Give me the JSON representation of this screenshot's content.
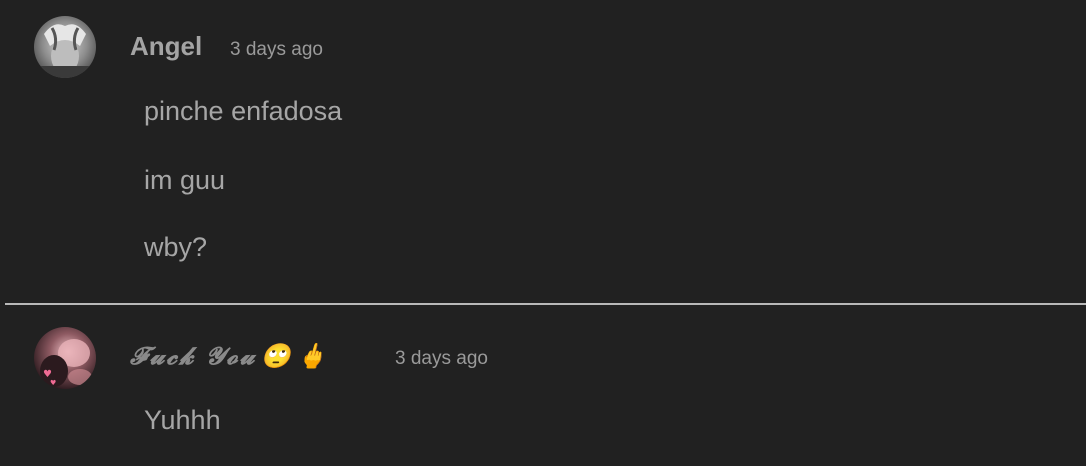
{
  "comments": [
    {
      "author": "Angel",
      "timestamp": "3 days ago",
      "lines": [
        "pinche enfadosa",
        "im guu",
        "wby?"
      ]
    },
    {
      "author": "𝓕𝓾𝓬𝓴 𝓨𝓸𝓾",
      "author_emojis": [
        "🙄",
        "🖕"
      ],
      "timestamp": "3 days ago",
      "lines": [
        "Yuhhh"
      ]
    }
  ],
  "colors": {
    "background": "#212121",
    "text": "#a3a3a3",
    "divider": "#b9b9b9"
  }
}
